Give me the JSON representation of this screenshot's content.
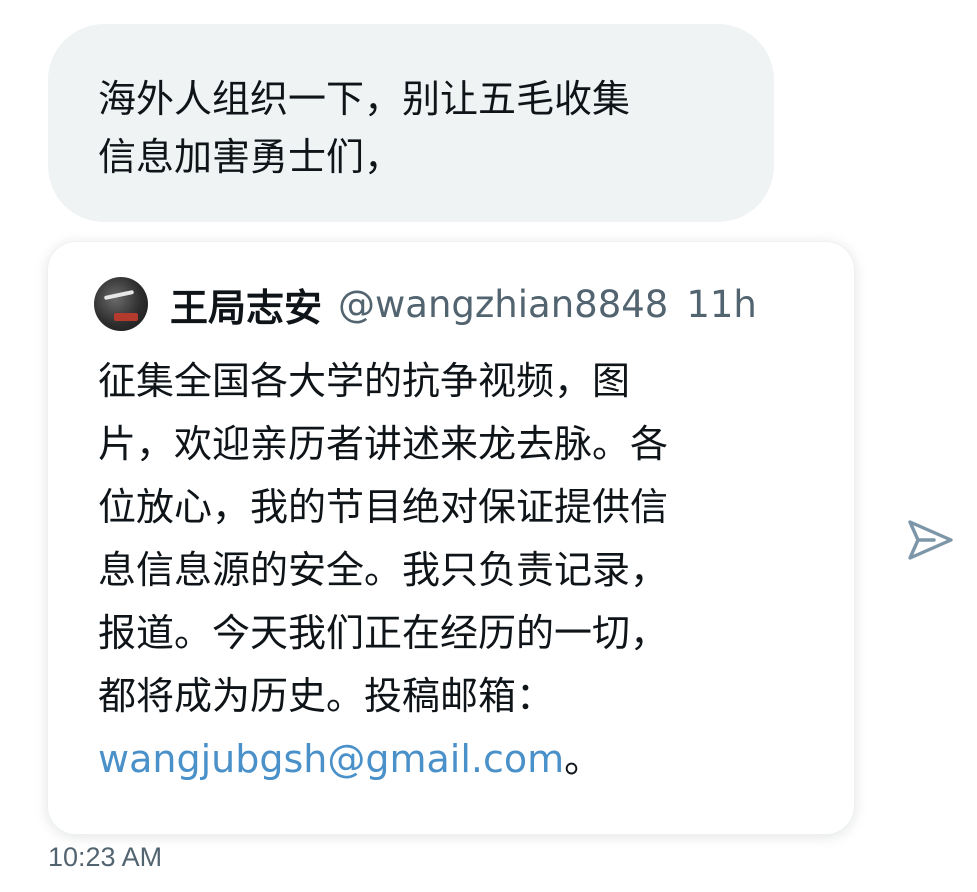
{
  "message": {
    "text_line1": "海外人组织一下，别让五毛收集",
    "text_line2": "信息加害勇士们，"
  },
  "quoted_tweet": {
    "author_name": "王局志安",
    "author_handle": "@wangzhian8848",
    "time_ago": "11h",
    "body_lines": [
      "征集全国各大学的抗争视频，图",
      "片，欢迎亲历者讲述来龙去脉。各",
      "位放心，我的节目绝对保证提供信",
      "息信息源的安全。我只负责记录，",
      "报道。今天我们正在经历的一切，",
      "都将成为历史。投稿邮箱："
    ],
    "email_link": "wangjubgsh@gmail.com",
    "body_end": "。"
  },
  "actions": {
    "share_icon": "send-icon"
  },
  "timestamp": "10:23 AM",
  "colors": {
    "bubble_bg": "#eff3f4",
    "text": "#0f1419",
    "secondary": "#536471",
    "link": "#4a90c9"
  }
}
